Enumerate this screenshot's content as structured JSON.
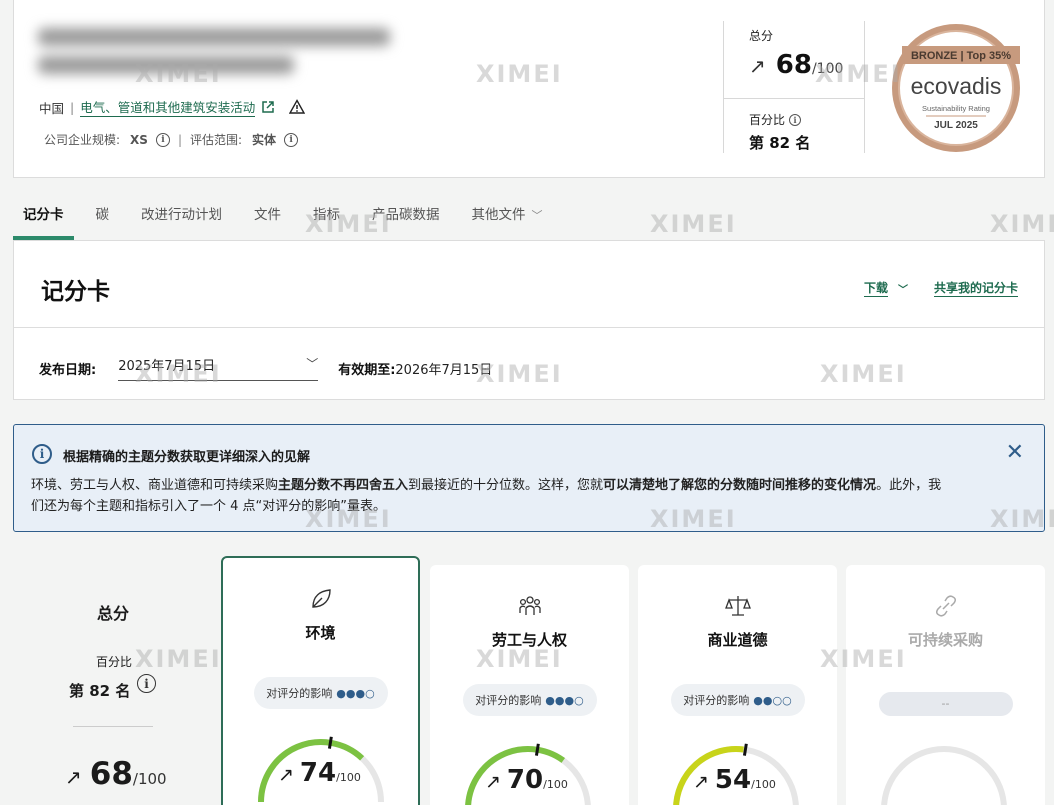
{
  "header": {
    "country": "中国",
    "industry": "电气、管道和其他建筑安装活动",
    "size_label": "公司企业规模:",
    "size_value": "XS",
    "scope_label": "评估范围:",
    "scope_value": "实体",
    "score_label": "总分",
    "score": "68",
    "score_max": "/100",
    "percentile_label": "百分比",
    "percentile_rank": "第 82 名",
    "medal": {
      "tier": "BRONZE",
      "top": "Top 35%",
      "brand": "ecovadis",
      "subtitle": "Sustainability Rating",
      "date": "JUL 2025"
    }
  },
  "tabs": [
    {
      "label": "记分卡"
    },
    {
      "label": "碳"
    },
    {
      "label": "改进行动计划"
    },
    {
      "label": "文件"
    },
    {
      "label": "指标"
    },
    {
      "label": "产品碳数据"
    },
    {
      "label": "其他文件"
    }
  ],
  "scorecard": {
    "title": "记分卡",
    "download_label": "下载",
    "share_label": "共享我的记分卡",
    "publish_label": "发布日期:",
    "publish_value": "2025年7月15日",
    "valid_label": "有效期至:",
    "valid_value": "2026年7月15日"
  },
  "banner": {
    "title": "根据精确的主题分数获取更详细深入的见解",
    "body_1": "环境、劳工与人权、商业道德和可持续采购",
    "body_bold_1": "主题分数不再四舍五入",
    "body_2": "到最接近的十分位数。这样，您就",
    "body_bold_2": "可以清楚地了解您的分数随时间推移的变化情况",
    "body_3": "。此外，我们还为每个主题和指标引入了一个 4 点“对评分的影响”量表。"
  },
  "overall": {
    "title": "总分",
    "percentile_label": "百分比",
    "percentile_rank": "第 82 名",
    "score": "68",
    "score_max": "/100"
  },
  "themes": [
    {
      "name": "环境",
      "impact_label": "对评分的影响",
      "impact_dots": "●●●○",
      "impact_level": 3,
      "score": "74",
      "score_max": "/100",
      "color": "#7cc242",
      "icon": "leaf-icon"
    },
    {
      "name": "劳工与人权",
      "impact_label": "对评分的影响",
      "impact_dots": "●●●○",
      "impact_level": 3,
      "score": "70",
      "score_max": "/100",
      "color": "#7cc242",
      "icon": "people-icon"
    },
    {
      "name": "商业道德",
      "impact_label": "对评分的影响",
      "impact_dots": "●●○○",
      "impact_level": 2,
      "score": "54",
      "score_max": "/100",
      "color": "#c8d41a",
      "icon": "scales-icon"
    },
    {
      "name": "可持续采购",
      "impact_label": "",
      "impact_dots": "--",
      "impact_level": 0,
      "score": "",
      "score_max": "",
      "color": "#dddddd",
      "icon": "link-icon"
    }
  ],
  "watermark": "XIMEI"
}
